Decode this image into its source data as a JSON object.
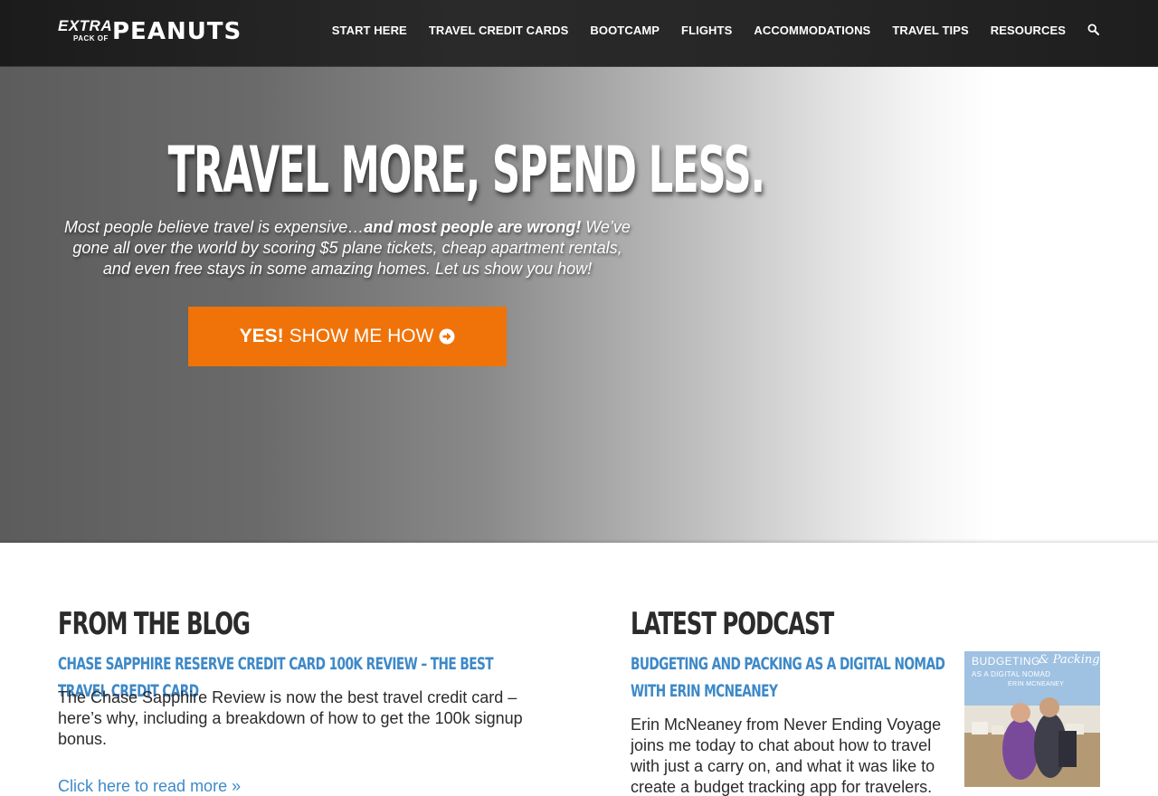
{
  "logo": {
    "extra": "EXTRA",
    "pack_of": "PACK OF",
    "peanuts": "PEANUTS"
  },
  "nav": {
    "items": [
      "START HERE",
      "TRAVEL CREDIT CARDS",
      "BOOTCAMP",
      "FLIGHTS",
      "ACCOMMODATIONS",
      "TRAVEL TIPS",
      "RESOURCES"
    ],
    "search_icon": "search-icon"
  },
  "hero": {
    "title": "TRAVEL MORE, SPEND LESS.",
    "subtitle_part1": "Most people believe travel is expensive…",
    "subtitle_bold": "and most people are wrong!",
    "subtitle_part2": " We’ve gone all over the world by scoring $5 plane tickets, cheap apartment rentals, and even free stays in some amazing homes. Let us show you how!",
    "cta_bold": "YES!",
    "cta_text": "SHOW ME HOW",
    "cta_icon": "arrow-circle-right-icon"
  },
  "blog": {
    "heading": "FROM THE BLOG",
    "post_title": "CHASE SAPPHIRE RESERVE CREDIT CARD 100K REVIEW – THE BEST TRAVEL CREDIT CARD",
    "excerpt": "The Chase Sapphire Review is now the best travel credit card – here’s why, including a breakdown of how to get the 100k signup bonus.",
    "read_more": "Click here to read more »"
  },
  "podcast": {
    "heading": "LATEST PODCAST",
    "episode_title": "BUDGETING AND PACKING AS A DIGITAL NOMAD WITH ERIN MCNEANEY",
    "excerpt": "Erin McNeaney from Never Ending Voyage joins me today to chat about how to travel with just a carry on, and what it was like to create a budget tracking app for travelers.",
    "thumb_line1": "BUDGETING",
    "thumb_line2": "& Packing",
    "thumb_line3": "AS A DIGITAL NOMAD",
    "thumb_line4": "ERIN MCNEANEY"
  },
  "colors": {
    "accent": "#ef7309",
    "link": "#3d89c8",
    "header_bg": "#222222"
  }
}
